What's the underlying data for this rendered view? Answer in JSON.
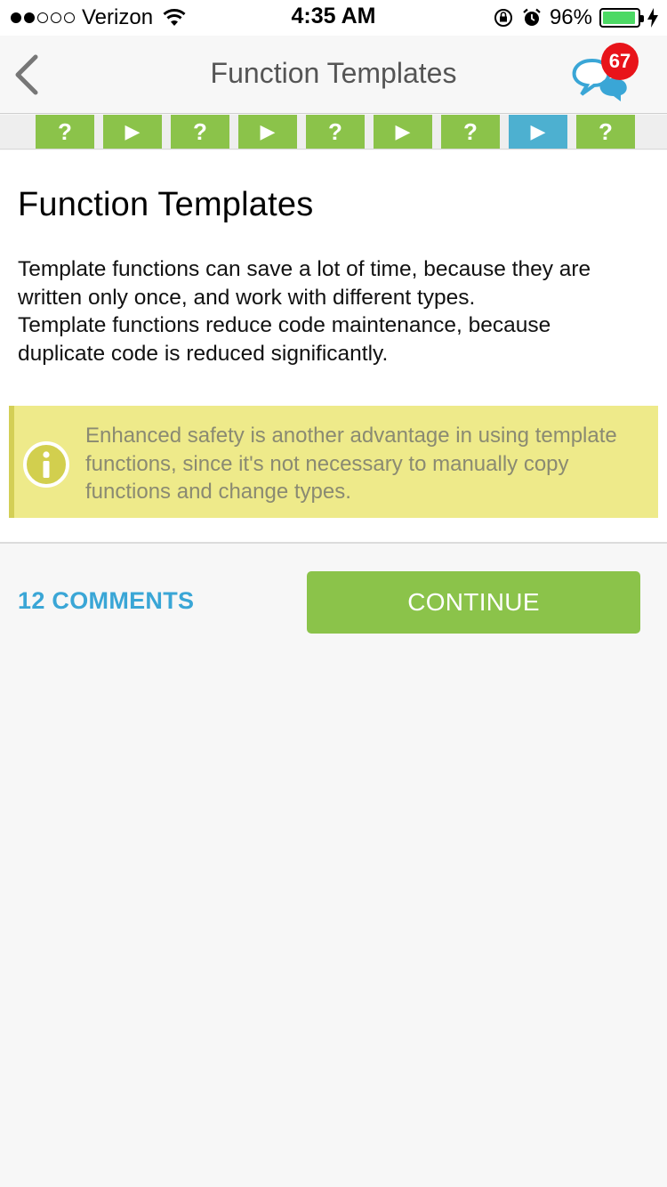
{
  "status_bar": {
    "signal": {
      "filled": 2,
      "total": 5
    },
    "carrier": "Verizon",
    "time": "4:35 AM",
    "battery_percent": "96%",
    "battery_level": 0.96,
    "icons": [
      "wifi-icon",
      "orientation-lock-icon",
      "alarm-icon",
      "battery-icon",
      "charging-bolt-icon"
    ]
  },
  "nav": {
    "title": "Function Templates",
    "back_icon": "chevron-left-icon",
    "chat_icon": "chat-bubbles-icon",
    "chat_badge": "67"
  },
  "progress_steps": [
    {
      "type": "quiz",
      "glyph": "?",
      "color": "#8bc34a"
    },
    {
      "type": "lesson",
      "glyph": "▶",
      "color": "#8bc34a"
    },
    {
      "type": "quiz",
      "glyph": "?",
      "color": "#8bc34a"
    },
    {
      "type": "lesson",
      "glyph": "▶",
      "color": "#8bc34a"
    },
    {
      "type": "quiz",
      "glyph": "?",
      "color": "#8bc34a"
    },
    {
      "type": "lesson",
      "glyph": "▶",
      "color": "#8bc34a"
    },
    {
      "type": "quiz",
      "glyph": "?",
      "color": "#8bc34a"
    },
    {
      "type": "lesson",
      "glyph": "▶",
      "color": "#4db0d0",
      "current": true
    },
    {
      "type": "quiz",
      "glyph": "?",
      "color": "#8bc34a"
    }
  ],
  "lesson": {
    "title": "Function Templates",
    "paragraph_1": "Template functions can save a lot of time, because they are written only once, and work with different types.",
    "paragraph_2": "Template functions reduce code maintenance, because duplicate code is reduced significantly.",
    "note": {
      "icon": "info-icon",
      "text": "Enhanced safety is another advantage in using template functions, since it's not necessary to manually copy functions and change types."
    }
  },
  "footer": {
    "comments_label": "12 COMMENTS",
    "continue_label": "CONTINUE"
  },
  "colors": {
    "accent_green": "#8bc34a",
    "accent_blue": "#4db0d0",
    "link_blue": "#3aa6d6",
    "badge_red": "#e8141a",
    "note_background": "#eeea8a"
  }
}
